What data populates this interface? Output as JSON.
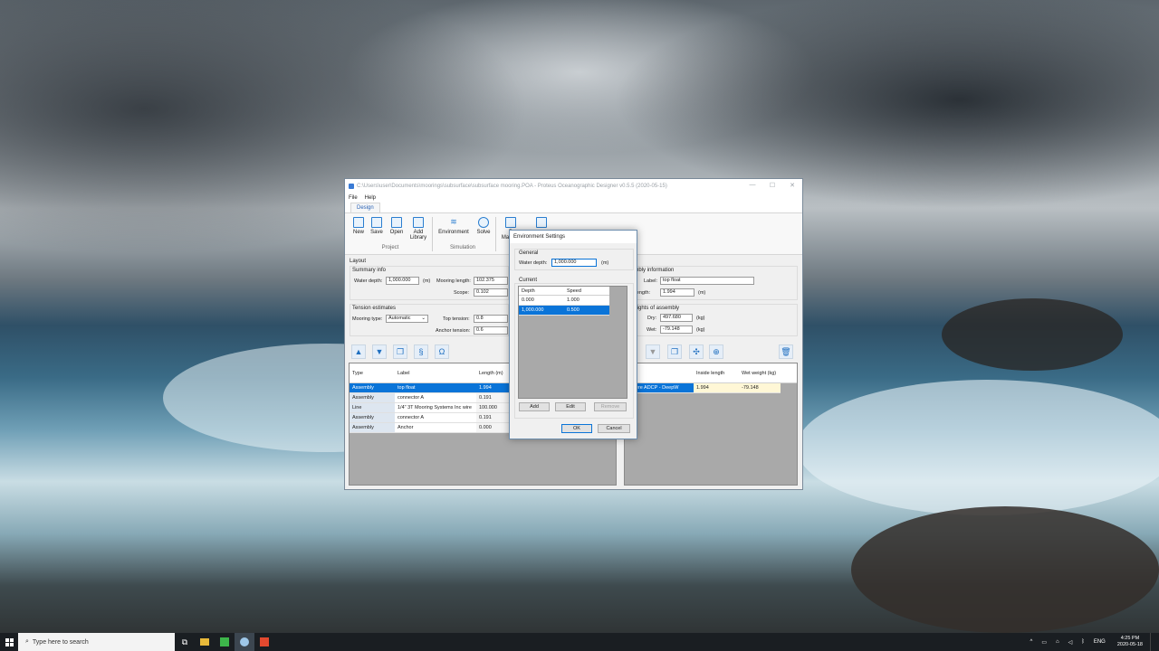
{
  "window": {
    "title": "C:\\Users\\user\\Documents\\moorings\\subsurface\\subsurface mooring.POA - Proteus Oceanographic Designer v0.5.5 (2020-05-15)",
    "minimize": "—",
    "maximize": "☐",
    "close": "✕"
  },
  "menu": [
    "File",
    "Help"
  ],
  "tab": "Design",
  "ribbon": {
    "new": "New",
    "save": "Save",
    "open": "Open",
    "add_library": "Add Library",
    "environment": "Environment",
    "solve": "Solve",
    "project_group": "Project",
    "simulation_group": "Simulation",
    "partial1": "B",
    "partial2": "Ma"
  },
  "layout": {
    "title": "Layout",
    "summary_info": "Summary info",
    "water_depth_label": "Water depth:",
    "water_depth": "1,000.000",
    "water_depth_unit": "(m)",
    "mooring_length_label": "Mooring length:",
    "mooring_length": "102.375",
    "scope_label": "Scope:",
    "scope": "0.102",
    "tension_estimates": "Tension estimates",
    "mooring_type_label": "Mooring type:",
    "mooring_type": "Automatic",
    "top_tension_label": "Top tension:",
    "top_tension": "0.8",
    "anchor_tension_label": "Anchor tension:",
    "anchor_tension": "0.6"
  },
  "grid_left": {
    "headers": [
      "Type",
      "Label",
      "Length (m)"
    ],
    "rows": [
      {
        "type": "Assembly",
        "label": "top float",
        "length": "1.994"
      },
      {
        "type": "Assembly",
        "label": "connector A",
        "length": "0.191"
      },
      {
        "type": "Line",
        "label": "1/4\" 3T Mooring Systems Inc wire",
        "length": "100.000"
      },
      {
        "type": "Assembly",
        "label": "connector A",
        "length": "0.191"
      },
      {
        "type": "Assembly",
        "label": "Anchor",
        "length": "0.000"
      }
    ]
  },
  "assembly": {
    "title_partial": "e",
    "info": "embly information",
    "label_label": "Label:",
    "label": "top float",
    "inside_length_label": "e length:",
    "inside_length": "1.994",
    "inside_length_unit": "(m)",
    "weights": "l weights of assembly",
    "dry_label": "Dry:",
    "dry": "497.680",
    "dry_unit": "(kg)",
    "wet_label": "Wet:",
    "wet": "-79.148",
    "wet_unit": "(kg)"
  },
  "grid_right": {
    "headers": [
      "e",
      "Inside length",
      "Wet weight (kg)"
    ],
    "rows": [
      {
        "name": "sphere ADCP - DeepW",
        "length": "1.994",
        "weight": "-79.148"
      }
    ]
  },
  "dialog": {
    "title": "Environment Settings",
    "general": "General",
    "water_depth_label": "Water depth:",
    "water_depth": "1,000.000",
    "unit": "(m)",
    "current": "Current",
    "headers": [
      "Depth",
      "Speed"
    ],
    "rows": [
      {
        "depth": "0.000",
        "speed": "1.000"
      },
      {
        "depth": "1,000.000",
        "speed": "0.500"
      }
    ],
    "add": "Add",
    "edit": "Edit",
    "remove": "Remove",
    "ok": "OK",
    "cancel": "Cancel"
  },
  "taskbar": {
    "search_placeholder": "Type here to search",
    "lang": "ENG",
    "time": "4:25 PM",
    "date": "2020-05-18"
  }
}
